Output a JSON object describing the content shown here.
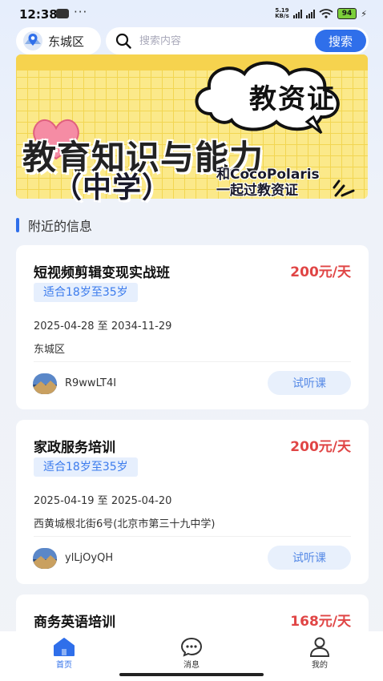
{
  "status_bar": {
    "time": "12:38",
    "dots": "···",
    "net_speed_value": "5.19",
    "net_speed_unit": "KB/s",
    "battery": "94"
  },
  "location": {
    "label": "东城区"
  },
  "search": {
    "placeholder": "搜索内容",
    "button_label": "搜索"
  },
  "banner": {
    "badge": "教资证",
    "title": "教育知识与能力",
    "subtitle": "（中学）",
    "tagline_line1": "和CocoPolaris",
    "tagline_line2": "一起过教资证"
  },
  "section": {
    "title": "附近的信息"
  },
  "cards": [
    {
      "title": "短视频剪辑变现实战班",
      "price": "200元/天",
      "tag": "适合18岁至35岁",
      "date_range": "2025-04-28 至 2034-11-29",
      "address": "东城区",
      "user": "R9wwLT4I",
      "button_label": "试听课"
    },
    {
      "title": "家政服务培训",
      "price": "200元/天",
      "tag": "适合18岁至35岁",
      "date_range": "2025-04-19 至 2025-04-20",
      "address": "西黄城根北街6号(北京市第三十九中学)",
      "user": "ylLjOyQH",
      "button_label": "试听课"
    },
    {
      "title": "商务英语培训",
      "price": "168元/天"
    }
  ],
  "tabbar": {
    "tabs": [
      {
        "label": "首页",
        "icon": "home-icon",
        "active": true
      },
      {
        "label": "消息",
        "icon": "message-icon",
        "active": false
      },
      {
        "label": "我的",
        "icon": "profile-icon",
        "active": false
      }
    ]
  },
  "colors": {
    "accent": "#2f6fea",
    "price": "#e04545",
    "tag_bg": "#e6effd",
    "banner_yellow": "#fbe98a"
  }
}
